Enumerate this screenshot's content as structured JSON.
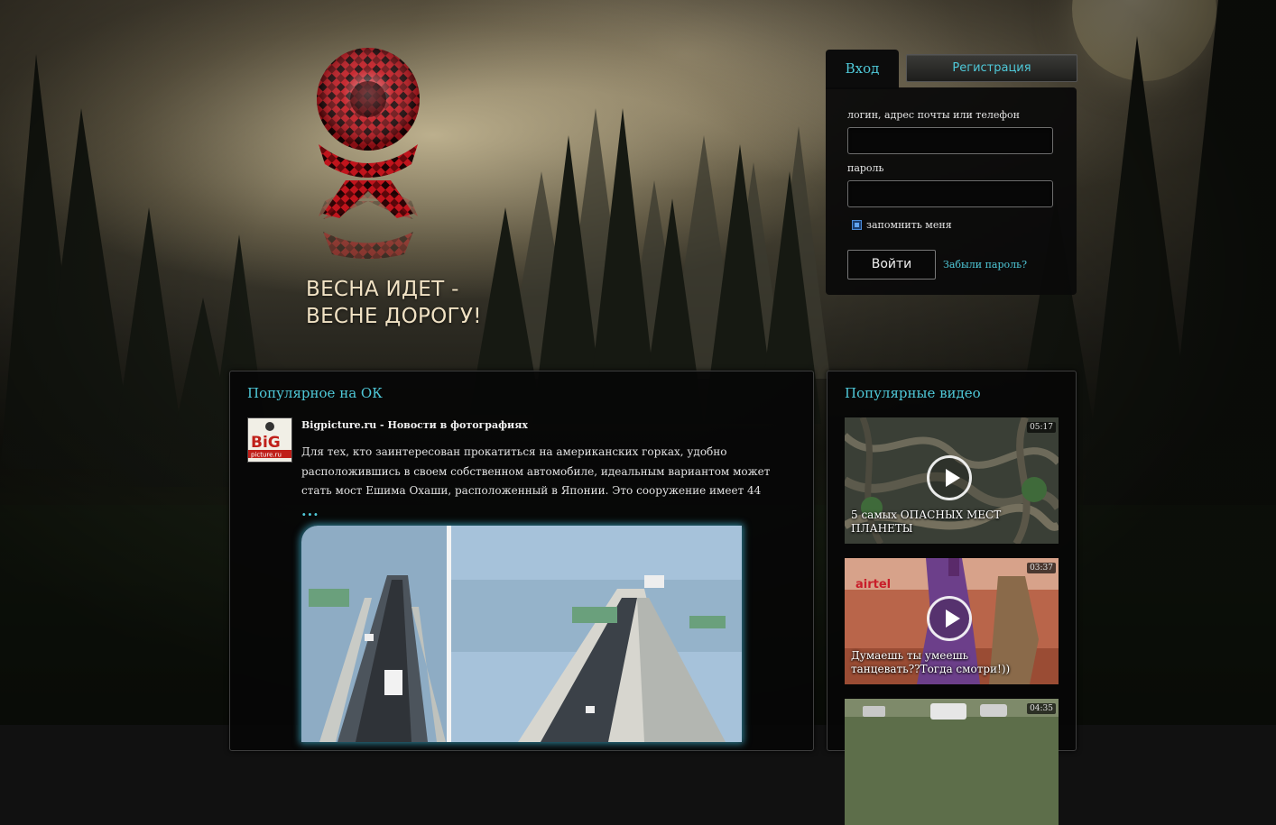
{
  "slogan": {
    "line1": "ВЕСНА ИДЕТ -",
    "line2": "ВЕСНЕ ДОРОГУ!"
  },
  "auth": {
    "tab_login": "Вход",
    "tab_register": "Регистрация",
    "login_label": "логин, адрес почты или телефон",
    "login_value": "",
    "password_label": "пароль",
    "password_value": "",
    "remember_label": "запомнить меня",
    "remember_checked": true,
    "submit_label": "Войти",
    "forgot_label": "Забыли пароль?"
  },
  "popular": {
    "title": "Популярное на ОК",
    "post": {
      "source": "Bigpicture.ru - Новости в фотографиях",
      "avatar_text_top": "BiG",
      "avatar_text_bottom": "picture.ru",
      "text": "Для тех, кто заинтересован прокатиться на американских горках, удобно расположившись в своем собственном автомобиле, идеальным вариантом может стать мост Ешима Охаши, расположенный в Японии. Это сооружение имеет 44",
      "more": "..."
    }
  },
  "videos": {
    "title": "Популярные видео",
    "items": [
      {
        "duration": "05:17",
        "title": "5 самых ОПАСНЫХ МЕСТ ПЛАНЕТЫ",
        "icon": "play-icon"
      },
      {
        "duration": "03:37",
        "title": "Думаешь ты умеешь танцевать??Тогда смотри!))",
        "icon": "play-icon"
      },
      {
        "duration": "04:35",
        "title": "",
        "icon": "play-icon"
      }
    ]
  },
  "colors": {
    "accent": "#4fc9d9",
    "panel": "#060606",
    "logo_red": "#c0141c"
  }
}
